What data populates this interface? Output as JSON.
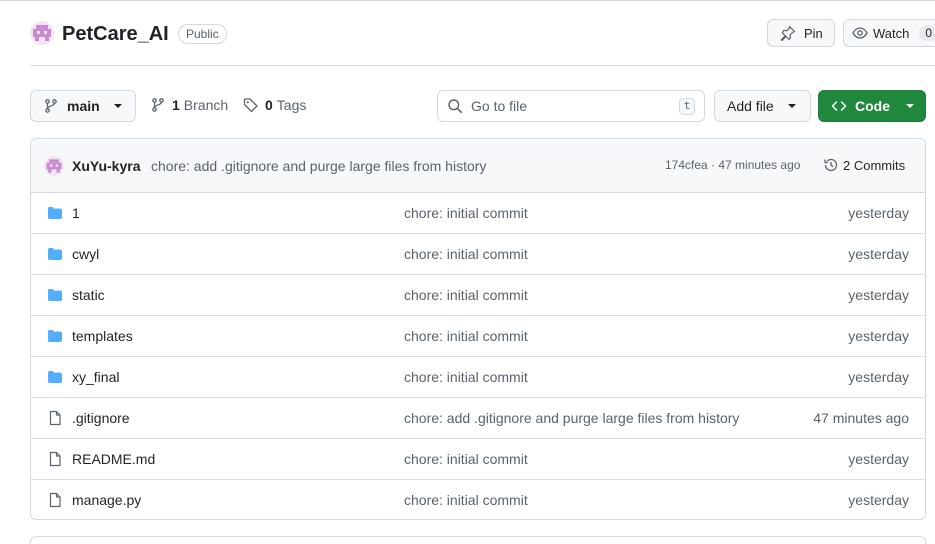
{
  "repo": {
    "name": "PetCare_AI",
    "visibility": "Public",
    "pin_label": "Pin",
    "watch_label": "Watch",
    "watch_count": "0"
  },
  "toolbar": {
    "branch": "main",
    "branch_count": "1",
    "branch_label": "Branch",
    "tag_count": "0",
    "tag_label": "Tags",
    "search_placeholder": "Go to file",
    "search_shortcut": "t",
    "add_file_label": "Add file",
    "code_label": "Code",
    "code_color": "#1f883d"
  },
  "latest_commit": {
    "author": "XuYu-kyra",
    "message": "chore: add .gitignore and purge large files from history",
    "sha_time": "174cfea · 47 minutes ago",
    "commits_label": "2 Commits"
  },
  "files": [
    {
      "type": "folder",
      "name": "1",
      "message": "chore: initial commit",
      "time": "yesterday"
    },
    {
      "type": "folder",
      "name": "cwyl",
      "message": "chore: initial commit",
      "time": "yesterday"
    },
    {
      "type": "folder",
      "name": "static",
      "message": "chore: initial commit",
      "time": "yesterday"
    },
    {
      "type": "folder",
      "name": "templates",
      "message": "chore: initial commit",
      "time": "yesterday"
    },
    {
      "type": "folder",
      "name": "xy_final",
      "message": "chore: initial commit",
      "time": "yesterday"
    },
    {
      "type": "file",
      "name": ".gitignore",
      "message": "chore: add .gitignore and purge large files from history",
      "time": "47 minutes ago"
    },
    {
      "type": "file",
      "name": "README.md",
      "message": "chore: initial commit",
      "time": "yesterday"
    },
    {
      "type": "file",
      "name": "manage.py",
      "message": "chore: initial commit",
      "time": "yesterday"
    }
  ],
  "colors": {
    "folder_icon": "#54aeff",
    "file_icon": "#59636e",
    "avatar": "#c88bd0"
  }
}
